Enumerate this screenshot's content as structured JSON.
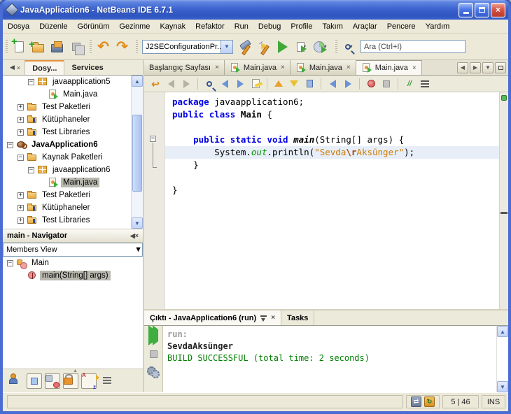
{
  "window": {
    "title": "JavaApplication6 - NetBeans IDE 6.7.1",
    "controls": [
      "minimize",
      "maximize",
      "close"
    ]
  },
  "colors": {
    "keyword": "#0000e6",
    "string": "#ce7b00",
    "field_green": "#009900",
    "build_success": "#008000",
    "selection_gray": "#b9b8af",
    "current_line": "#e7eef8",
    "titlebar_blue": "#3c63cf",
    "toolbar_beige": "#ece9d8"
  },
  "menubar": [
    "Dosya",
    "Düzenle",
    "Görünüm",
    "Gezinme",
    "Kaynak",
    "Refaktor",
    "Run",
    "Debug",
    "Profile",
    "Takım",
    "Araçlar",
    "Pencere",
    "Yardım"
  ],
  "toolbar": {
    "file_group": [
      "new-file",
      "new-project",
      "open-project",
      "save-all"
    ],
    "undo_group": [
      "undo",
      "redo"
    ],
    "config_combo_value": "J2SEConfigurationPr...",
    "build_group": [
      "build",
      "clean-build",
      "run-project",
      "debug-project",
      "profile-project"
    ],
    "search_placeholder": "Ara (Ctrl+I)"
  },
  "projects_panel": {
    "panel_buttons": [
      "minimize-panel",
      "close-panel"
    ],
    "tabs": [
      {
        "label": "Dosy...",
        "active": true
      },
      {
        "label": "Services",
        "active": false
      }
    ],
    "tree": [
      {
        "indent": 2,
        "exp": "minus",
        "icon": "package",
        "label": "javaapplication5"
      },
      {
        "indent": 3,
        "exp": null,
        "icon": "java",
        "label": "Main.java"
      },
      {
        "indent": 1,
        "exp": "plus",
        "icon": "folder",
        "label": "Test Paketleri"
      },
      {
        "indent": 1,
        "exp": "plus",
        "icon": "lib",
        "label": "Kütüphaneler"
      },
      {
        "indent": 1,
        "exp": "plus",
        "icon": "lib",
        "label": "Test Libraries"
      },
      {
        "indent": 0,
        "exp": "minus",
        "icon": "project",
        "label": "JavaApplication6",
        "bold": true
      },
      {
        "indent": 1,
        "exp": "minus",
        "icon": "folder",
        "label": "Kaynak Paketleri"
      },
      {
        "indent": 2,
        "exp": "minus",
        "icon": "package",
        "label": "javaapplication6"
      },
      {
        "indent": 3,
        "exp": null,
        "icon": "java",
        "label": "Main.java",
        "selected": true
      },
      {
        "indent": 1,
        "exp": "plus",
        "icon": "folder",
        "label": "Test Paketleri"
      },
      {
        "indent": 1,
        "exp": "plus",
        "icon": "lib",
        "label": "Kütüphaneler"
      },
      {
        "indent": 1,
        "exp": "plus",
        "icon": "lib",
        "label": "Test Libraries"
      }
    ]
  },
  "navigator": {
    "title": "main - Navigator",
    "view_combo_value": "Members View",
    "tree": [
      {
        "indent": 0,
        "exp": "minus",
        "icon": "class",
        "label": "Main"
      },
      {
        "indent": 1,
        "exp": null,
        "icon": "method",
        "label": "main(String[] args)",
        "selected": true
      }
    ],
    "filter_buttons": [
      {
        "name": "show-inherited-members",
        "icon": "inherited",
        "framed": false
      },
      {
        "name": "show-fields",
        "icon": "fields",
        "framed": true
      },
      {
        "name": "show-static-members",
        "icon": "static",
        "framed": true
      },
      {
        "name": "show-non-public-members",
        "icon": "lock",
        "framed": true
      },
      {
        "name": "sort-alphabetically",
        "icon": "alpha",
        "framed": true
      },
      {
        "name": "sort-by-source",
        "icon": "source",
        "framed": false
      }
    ]
  },
  "editor": {
    "tabs": [
      {
        "label": "Başlangıç Sayfası",
        "icon": false,
        "active": false
      },
      {
        "label": "Main.java",
        "icon": true,
        "active": false
      },
      {
        "label": "Main.java",
        "icon": true,
        "active": false
      },
      {
        "label": "Main.java",
        "icon": true,
        "active": true
      }
    ],
    "tab_controls": [
      "scroll-tabs-left",
      "scroll-tabs-right",
      "tab-list-dropdown",
      "maximize-window"
    ],
    "toolbar_icons": [
      "last-edit-position",
      "back",
      "forward",
      "|",
      "find-selection",
      "find-previous",
      "find-next",
      "toggle-highlight",
      "|",
      "previous-bookmark",
      "next-bookmark",
      "toggle-bookmark",
      "|",
      "shift-left",
      "shift-right",
      "|",
      "start-macro-recording",
      "stop-macro-recording",
      "|",
      "comment",
      "uncomment"
    ],
    "current_line_index": 4,
    "code_lines": [
      [
        {
          "c": "kw",
          "t": "package"
        },
        {
          "c": "pl",
          "t": " javaapplication6;"
        }
      ],
      [
        {
          "c": "kw",
          "t": "public"
        },
        {
          "c": "pl",
          "t": " "
        },
        {
          "c": "kw",
          "t": "class"
        },
        {
          "c": "pl",
          "t": " "
        },
        {
          "c": "cls",
          "t": "Main"
        },
        {
          "c": "pl",
          "t": " {"
        }
      ],
      [],
      [
        {
          "c": "pl",
          "t": "    "
        },
        {
          "c": "kw",
          "t": "public"
        },
        {
          "c": "pl",
          "t": " "
        },
        {
          "c": "kw",
          "t": "static"
        },
        {
          "c": "pl",
          "t": " "
        },
        {
          "c": "kw",
          "t": "void"
        },
        {
          "c": "pl",
          "t": " "
        },
        {
          "c": "mth",
          "t": "main"
        },
        {
          "c": "pl",
          "t": "(String[] args) {"
        }
      ],
      [
        {
          "c": "pl",
          "t": "        System."
        },
        {
          "c": "fld",
          "t": "out"
        },
        {
          "c": "pl",
          "t": ".println("
        },
        {
          "c": "str",
          "t": "\"Sevda"
        },
        {
          "c": "esc",
          "t": "\\r"
        },
        {
          "c": "str",
          "t": "Aksünger\""
        },
        {
          "c": "pl",
          "t": ");"
        }
      ],
      [
        {
          "c": "pl",
          "t": "    }"
        }
      ],
      [],
      [
        {
          "c": "pl",
          "t": "}"
        }
      ]
    ]
  },
  "output": {
    "tabs": [
      {
        "label": "Çıktı - JavaApplication6 (run)",
        "active": true
      },
      {
        "label": "Tasks",
        "active": false
      }
    ],
    "side_buttons": [
      "rerun",
      "stop",
      "ant-settings"
    ],
    "lines": [
      {
        "t": "run:",
        "c": "info"
      },
      {
        "t": "SevdaAksünger",
        "c": "plain"
      },
      {
        "t": "BUILD SUCCESSFUL (total time: 2 seconds)",
        "c": "success"
      }
    ]
  },
  "statusbar": {
    "icons": [
      "sync",
      "updates"
    ],
    "caret_position": "5 | 46",
    "insert_mode": "INS"
  }
}
